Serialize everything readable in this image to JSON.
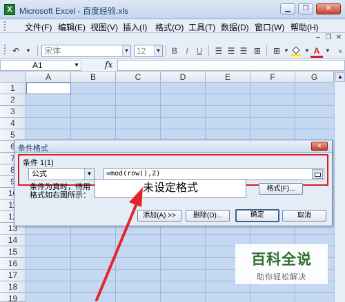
{
  "window": {
    "title": "Microsoft Excel - 百度经验.xls",
    "minimize": "▁",
    "restore": "❐",
    "close": "✕"
  },
  "menu": {
    "items": [
      "文件(F)",
      "编辑(E)",
      "视图(V)",
      "插入(I)",
      "格式(O)",
      "工具(T)",
      "数据(D)",
      "窗口(W)",
      "帮助(H)"
    ],
    "mdi_min": "–",
    "mdi_restore": "❐",
    "mdi_close": "✕"
  },
  "toolbar": {
    "undo": "↶",
    "font_name": "宋体",
    "font_size": "12",
    "bold": "B",
    "italic": "I",
    "underline": "U",
    "fill_color": "#f5e31b",
    "font_color": "#d01b1b",
    "font_color_glyph": "A"
  },
  "formula_bar": {
    "cell_ref": "A1",
    "fx": "fx"
  },
  "grid": {
    "columns": [
      "A",
      "B",
      "C",
      "D",
      "E",
      "F",
      "G"
    ],
    "rows": [
      "1",
      "2",
      "3",
      "4",
      "5",
      "6",
      "7",
      "8",
      "9",
      "10",
      "11",
      "12",
      "13",
      "14",
      "15",
      "16",
      "17",
      "18",
      "19"
    ]
  },
  "dialog": {
    "title": "条件格式",
    "close": "✕",
    "condition_label": "条件 1(1)",
    "type_value": "公式",
    "formula_value": "=mod(row(),2)",
    "hint": "条件为真时，待用格式如右图所示：",
    "preview_text": "未设定格式",
    "format_button": "格式(F)...",
    "add_button": "添加(A) >>",
    "delete_button": "删除(D)...",
    "ok_button": "确定",
    "cancel_button": "取消"
  },
  "annotation": {
    "arrow_color": "#e0262b",
    "highlight_color": "#d21f1f"
  },
  "watermark": {
    "main": "百科全说",
    "sub": "助你轻松解决",
    "color": "#2f6e2e"
  }
}
